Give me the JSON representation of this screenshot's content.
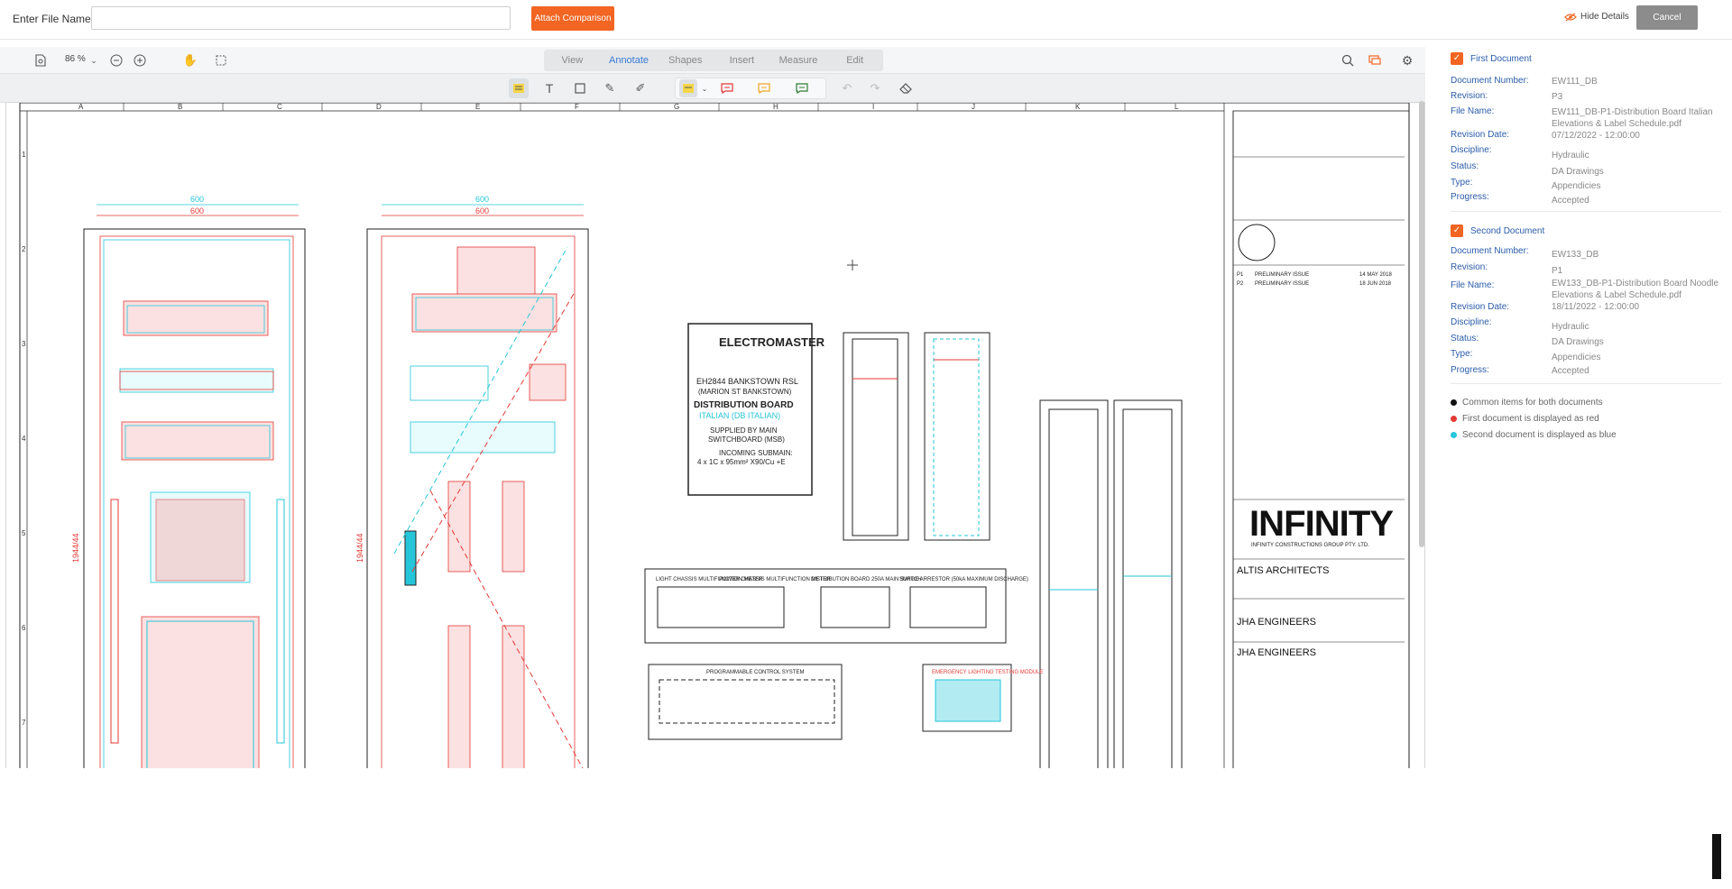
{
  "topbar": {
    "file_label": "Enter File Name",
    "file_value": "",
    "attach_label": "Attach Comparison",
    "hide_details_label": "Hide Details",
    "cancel_label": "Cancel"
  },
  "viewer": {
    "zoom": "86 %",
    "tabs": [
      {
        "label": "View"
      },
      {
        "label": "Annotate"
      },
      {
        "label": "Shapes"
      },
      {
        "label": "Insert"
      },
      {
        "label": "Measure"
      },
      {
        "label": "Edit"
      }
    ],
    "active_tab": "Annotate"
  },
  "drawing": {
    "columns": [
      "A",
      "B",
      "C",
      "D",
      "E",
      "F",
      "G",
      "H",
      "I",
      "J",
      "K",
      "L"
    ],
    "rows": [
      "1",
      "2",
      "3",
      "4",
      "5",
      "6",
      "7"
    ],
    "dim1": "600",
    "dim2": "600",
    "height_dim": "1944/44",
    "brand": "ELECTROMASTER",
    "sign_line1": "EH2844 BANKSTOWN RSL",
    "sign_line2": "(MARION ST BANKSTOWN)",
    "sign_line3": "DISTRIBUTION BOARD",
    "sign_line4": "ITALIAN (DB ITALIAN)",
    "sign_line5": "SUPPLIED BY MAIN",
    "sign_line6": "SWITCHBOARD (MSB)",
    "sign_line7": "INCOMING SUBMAIN:",
    "sign_line8": "4 x 1C x 95mm² X90/Cu +E",
    "panel1": "LIGHT CHASSIS MULTIFUNCTION METER",
    "panel2": "POWER CHASSIS MULTIFUNCTION METER",
    "panel3": "DISTRIBUTION BOARD 250A MAIN SWITCH",
    "panel4": "SURGE ARRESTOR (50kA MAXIMUM DISCHARGE)",
    "panel5": "PROGRAMMABLE CONTROL SYSTEM",
    "panel6": "EMERGENCY LIGHTING TESTING MODULE",
    "logo": "INFINITY",
    "logo_sub": "INFINITY CONSTRUCTIONS GROUP PTY. LTD.",
    "arch": "ALTIS ARCHITECTS",
    "eng1": "JHA ENGINEERS",
    "eng2": "JHA ENGINEERS",
    "issue1_code": "P1",
    "issue1_desc": "PRELIMINARY ISSUE",
    "issue1_date": "14 MAY 2018",
    "issue2_code": "P2",
    "issue2_desc": "PRELIMINARY ISSUE",
    "issue2_date": "18 JUN 2018"
  },
  "side": {
    "first": {
      "title": "First Document",
      "labels": {
        "number": "Document Number:",
        "revision": "Revision:",
        "file": "File Name:",
        "date": "Revision Date:",
        "discipline": "Discipline:",
        "status": "Status:",
        "type": "Type:",
        "progress": "Progress:"
      },
      "number": "EW111_DB",
      "revision": "P3",
      "file": "EW111_DB-P1-Distribution Board Italian Elevations & Label Schedule.pdf",
      "date": "07/12/2022 - 12:00:00",
      "discipline": "Hydraulic",
      "status": "DA Drawings",
      "type": "Appendicies",
      "progress": "Accepted"
    },
    "second": {
      "title": "Second Document",
      "labels": {
        "number": "Document Number:",
        "revision": "Revision:",
        "file": "File Name:",
        "date": "Revision Date:",
        "discipline": "Discipline:",
        "status": "Status:",
        "type": "Type:",
        "progress": "Progress:"
      },
      "number": "EW133_DB",
      "revision": "P1",
      "file": "EW133_DB-P1-Distribution Board Noodle Elevations & Label Schedule.pdf",
      "date": "18/11/2022 - 12:00:00",
      "discipline": "Hydraulic",
      "status": "DA Drawings",
      "type": "Appendicies",
      "progress": "Accepted"
    },
    "legend": [
      {
        "text": "Common items for both documents",
        "color": "#111111"
      },
      {
        "text": "First document is displayed as red",
        "color": "#e53935"
      },
      {
        "text": "Second document is displayed as blue",
        "color": "#26c6da"
      }
    ]
  }
}
